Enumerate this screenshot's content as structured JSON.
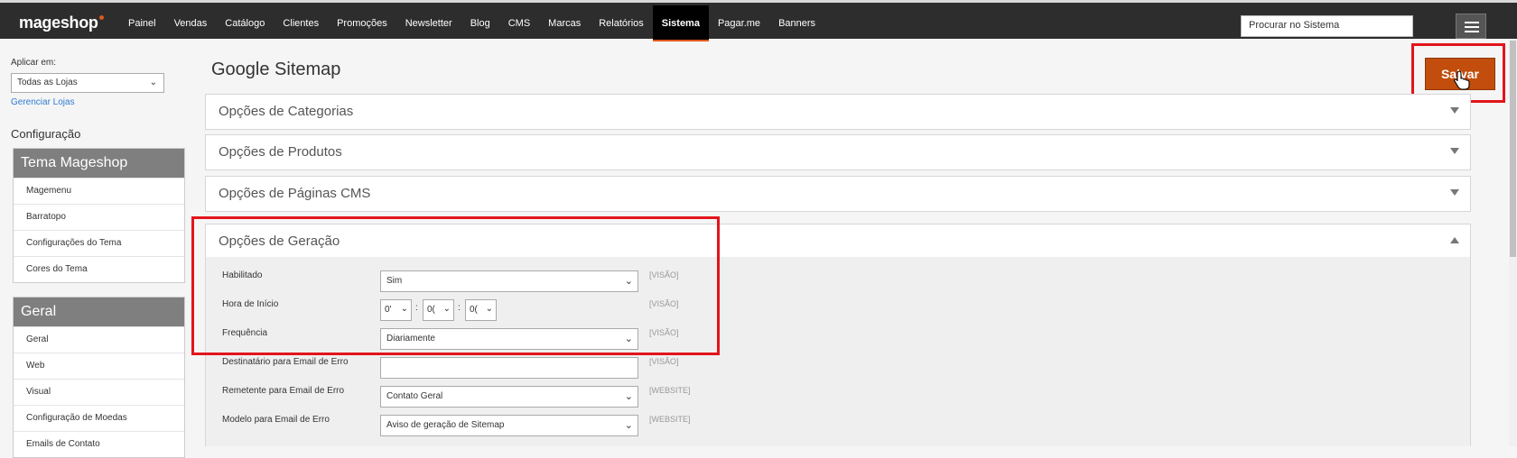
{
  "header": {
    "logo": "mageshop",
    "nav": [
      "Painel",
      "Vendas",
      "Catálogo",
      "Clientes",
      "Promoções",
      "Newsletter",
      "Blog",
      "CMS",
      "Marcas",
      "Relatórios",
      "Sistema",
      "Pagar.me",
      "Banners"
    ],
    "active_nav": "Sistema",
    "search_placeholder": "Procurar no Sistema"
  },
  "sidebar": {
    "apply_label": "Aplicar em:",
    "store_value": "Todas as Lojas",
    "manage_link": "Gerenciar Lojas",
    "config_title": "Configuração",
    "groups": [
      {
        "title": "Tema Mageshop",
        "items": [
          "Magemenu",
          "Barratopo",
          "Configurações do Tema",
          "Cores do Tema"
        ]
      },
      {
        "title": "Geral",
        "items": [
          "Geral",
          "Web",
          "Visual",
          "Configuração de Moedas",
          "Emails de Contato"
        ]
      }
    ]
  },
  "page": {
    "title": "Google Sitemap",
    "save_label": "Salvar"
  },
  "panels": [
    "Opções de Categorias",
    "Opções de Produtos",
    "Opções de Páginas CMS",
    "Opções de Geração"
  ],
  "fields": {
    "enabled": {
      "label": "Habilitado",
      "value": "Sim",
      "scope": "[VISÃO]"
    },
    "start_time": {
      "label": "Hora de Início",
      "hour": "0'",
      "minute": "0(",
      "second": "0(",
      "scope": "[VISÃO]"
    },
    "frequency": {
      "label": "Frequência",
      "value": "Diariamente",
      "scope": "[VISÃO]"
    },
    "error_recipient": {
      "label": "Destinatário para Email de Erro",
      "value": "",
      "scope": "[VISÃO]"
    },
    "error_sender": {
      "label": "Remetente para Email de Erro",
      "value": "Contato Geral",
      "scope": "[WEBSITE]"
    },
    "error_template": {
      "label": "Modelo para Email de Erro",
      "value": "Aviso de geração de Sitemap",
      "scope": "[WEBSITE]"
    }
  },
  "colors": {
    "topbar": "#2d2d2d",
    "accent": "#c24d0c",
    "highlight": "#e3141b",
    "link": "#2f7bd2"
  }
}
